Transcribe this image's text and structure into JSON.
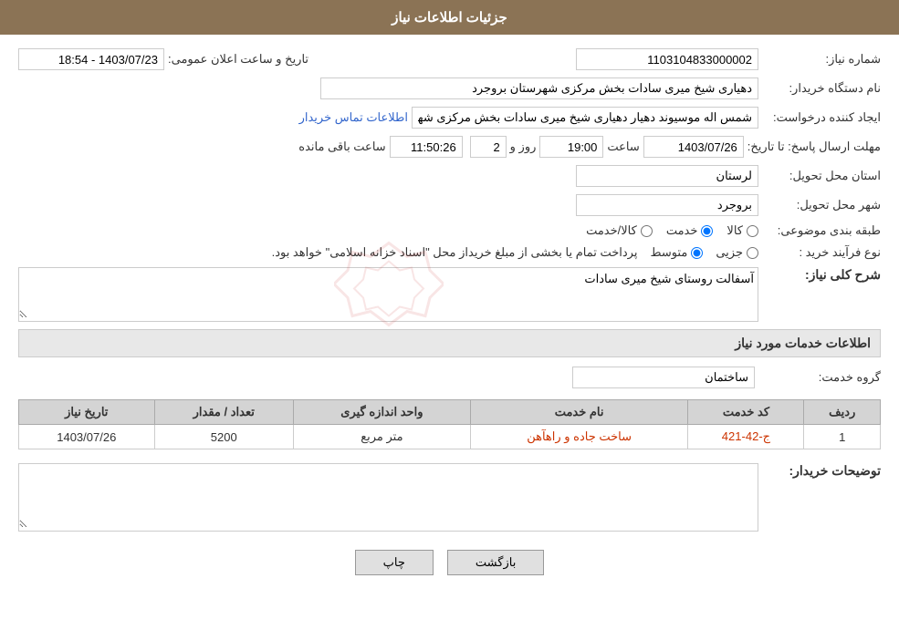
{
  "header": {
    "title": "جزئیات اطلاعات نیاز"
  },
  "fields": {
    "shomara_niaz_label": "شماره نیاز:",
    "shomara_niaz_value": "1103104833000002",
    "name_dastgah_label": "نام دستگاه خریدار:",
    "name_dastgah_value": "دهیاری شیخ میری سادات بخش مرکزی شهرستان بروجرد",
    "ijad_konande_label": "ایجاد کننده درخواست:",
    "ijad_konande_value": "شمس اله موسیوند دهیار دهیاری شیخ میری سادات بخش مرکزی شهرستان بر",
    "ijad_konande_link": "اطلاعات تماس خریدار",
    "mohlat_label": "مهلت ارسال پاسخ: تا تاریخ:",
    "tarikh_value": "1403/07/26",
    "saat_label": "ساعت",
    "saat_value": "19:00",
    "roz_label": "روز و",
    "roz_value": "2",
    "countdown_value": "11:50:26",
    "saat_baghi_label": "ساعت باقی مانده",
    "ostan_label": "استان محل تحویل:",
    "ostan_value": "لرستان",
    "shahr_label": "شهر محل تحویل:",
    "shahr_value": "بروجرد",
    "tabaqe_label": "طبقه بندی موضوعی:",
    "tabaqe_options": [
      "کالا",
      "خدمت",
      "کالا/خدمت"
    ],
    "tabaqe_selected": "خدمت",
    "nooe_farayand_label": "نوع فرآیند خرید :",
    "nooe_farayand_options": [
      "جزیی",
      "متوسط"
    ],
    "nooe_farayand_selected": "متوسط",
    "nooe_farayand_description": "پرداخت تمام یا بخشی از مبلغ خریداز محل \"اسناد خزانه اسلامی\" خواهد بود.",
    "sharh_koli_label": "شرح کلی نیاز:",
    "sharh_koli_value": "آسفالت روستای شیخ میری سادات",
    "etelaat_khadamat_label": "اطلاعات خدمات مورد نیاز",
    "gorohe_khadamat_label": "گروه خدمت:",
    "gorohe_khadamat_value": "ساختمان",
    "tarikh_niaz_header": "تاریخ نیاز",
    "tedad_header": "تعداد / مقدار",
    "vahed_header": "واحد اندازه گیری",
    "name_khadamat_header": "نام خدمت",
    "code_khadamat_header": "کد خدمت",
    "radif_header": "ردیف",
    "table_rows": [
      {
        "radif": "1",
        "code": "ج-42-421",
        "name": "ساخت جاده و راهآهن",
        "vahed": "متر مربع",
        "tedad": "5200",
        "tarikh": "1403/07/26"
      }
    ],
    "tosihaat_label": "توضیحات خریدار:",
    "tosihaat_value": "",
    "announce_label": "تاریخ و ساعت اعلان عمومی:",
    "announce_value": "1403/07/23 - 18:54",
    "back_button": "بازگشت",
    "print_button": "چاپ"
  }
}
